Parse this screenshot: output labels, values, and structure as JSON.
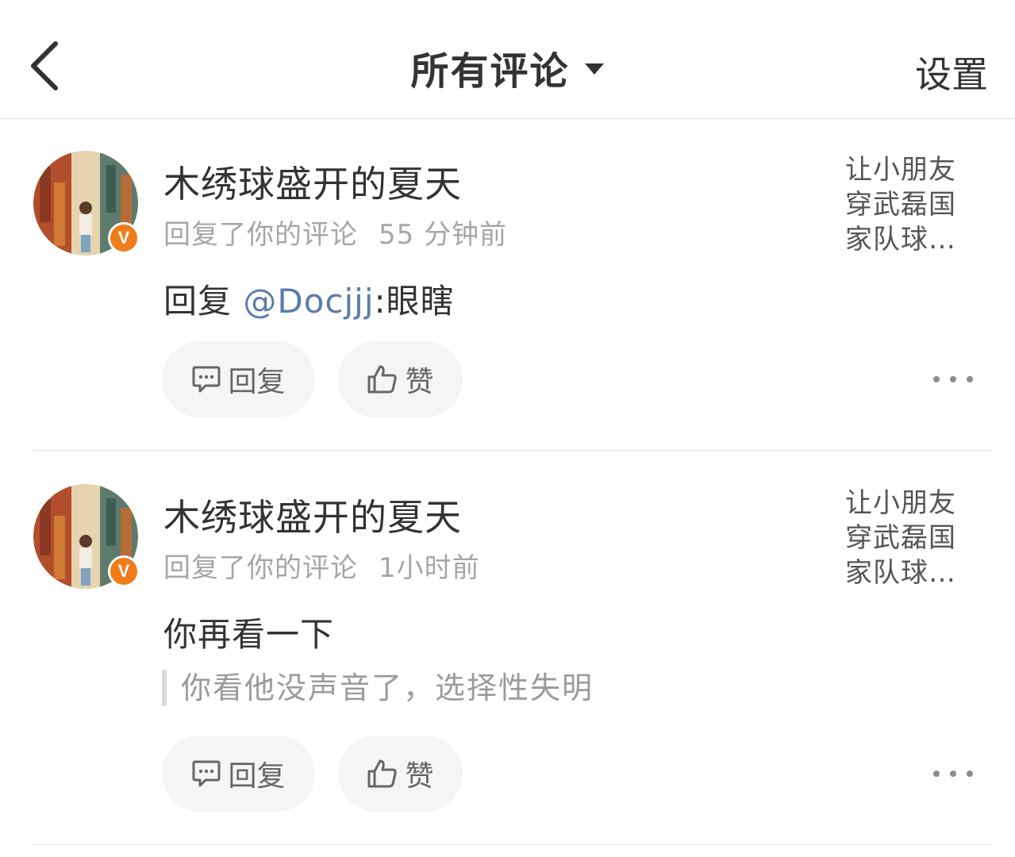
{
  "header": {
    "title": "所有评论",
    "settings_label": "设置"
  },
  "comments": [
    {
      "username": "木绣球盛开的夏天",
      "action": "回复了你的评论",
      "time": "55 分钟前",
      "context": "让小朋友穿武磊国家队球…",
      "body_prefix": "回复 ",
      "mention": "@Docjjj",
      "body_suffix": ":眼瞎",
      "quote": "",
      "reply_label": "回复",
      "like_label": "赞"
    },
    {
      "username": "木绣球盛开的夏天",
      "action": "回复了你的评论",
      "time": "1小时前",
      "context": "让小朋友穿武磊国家队球…",
      "body": "你再看一下",
      "quote": "你看他没声音了，选择性失明",
      "reply_label": "回复",
      "like_label": "赞"
    }
  ],
  "icons": {
    "back": "chevron-left-icon",
    "title_dropdown": "caret-down-icon",
    "reply": "comment-bubble-icon",
    "like": "thumbs-up-icon",
    "more": "more-dots-icon"
  },
  "colors": {
    "mention": "#5b7bab",
    "vip_badge": "#f27b1a",
    "meta_text": "#a6a6a6",
    "pill_bg": "#f5f5f5"
  }
}
